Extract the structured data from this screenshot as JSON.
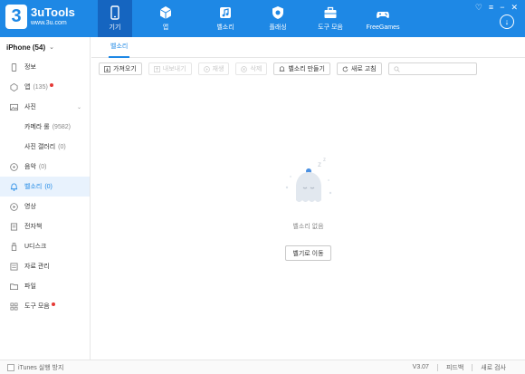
{
  "app": {
    "logo_glyph": "3",
    "name": "3uTools",
    "url": "www.3u.com",
    "accent": "#1e88e5"
  },
  "nav": [
    {
      "label": "기기",
      "icon": "phone-icon",
      "active": true
    },
    {
      "label": "앱",
      "icon": "cube-icon",
      "active": false
    },
    {
      "label": "벨소리",
      "icon": "music-note-icon",
      "active": false
    },
    {
      "label": "플래싱",
      "icon": "shield-icon",
      "active": false
    },
    {
      "label": "도구 모음",
      "icon": "toolbox-icon",
      "active": false
    },
    {
      "label": "FreeGames",
      "icon": "gamepad-icon",
      "active": false
    }
  ],
  "window_controls": [
    "shirt-icon",
    "menu-icon",
    "minimize-icon",
    "close-icon"
  ],
  "sidebar": {
    "device_name": "iPhone (54)",
    "items": [
      {
        "label": "정보",
        "count": "",
        "icon": "phone-icon",
        "dot": false
      },
      {
        "label": "앱",
        "count": "(135)",
        "icon": "apps-icon",
        "dot": true
      },
      {
        "label": "사진",
        "count": "",
        "icon": "photo-icon",
        "dot": false,
        "expandable": true
      },
      {
        "label": "카메라 롤",
        "count": "(9582)",
        "sub": true
      },
      {
        "label": "사진 갤러리",
        "count": "(0)",
        "sub": true
      },
      {
        "label": "음악",
        "count": "(0)",
        "icon": "music-icon",
        "dot": false
      },
      {
        "label": "벨소리",
        "count": "(0)",
        "icon": "bell-icon",
        "dot": false,
        "active": true
      },
      {
        "label": "영상",
        "count": "",
        "icon": "video-icon",
        "dot": false
      },
      {
        "label": "전자책",
        "count": "",
        "icon": "book-icon",
        "dot": false
      },
      {
        "label": "U디스크",
        "count": "",
        "icon": "usb-icon",
        "dot": false
      },
      {
        "label": "자료 관리",
        "count": "",
        "icon": "data-icon",
        "dot": false
      },
      {
        "label": "파일",
        "count": "",
        "icon": "folder-icon",
        "dot": false
      },
      {
        "label": "도구 모음",
        "count": "",
        "icon": "grid-icon",
        "dot": true
      }
    ]
  },
  "main": {
    "tab": "벨소리",
    "toolbar": {
      "import": "가져오기",
      "export": "내보내기",
      "delete_all": "재생",
      "delete": "삭제",
      "make": "벨소리 만들기",
      "refresh": "새로 고침",
      "search_placeholder": ""
    },
    "empty_label": "벨소리 없음",
    "goto_button": "벨기로 이동"
  },
  "status": {
    "itunes_label": "iTunes 실행 방지",
    "version": "V3.07",
    "feedback": "피드백",
    "update": "새로 검사"
  }
}
